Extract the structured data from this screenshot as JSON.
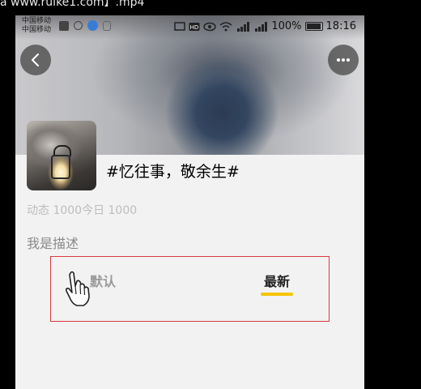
{
  "video": {
    "title": "a www.ruike1.com】.mp4"
  },
  "status_bar": {
    "carrier_1": "中国移动",
    "carrier_2": "中国移动",
    "battery": "100%",
    "time": "18:16"
  },
  "nav": {
    "back_icon": "chevron-left-icon",
    "more_icon": "ellipsis-icon"
  },
  "topic": {
    "title": "#忆往事，敬余生#",
    "stats": "动态 1000今日 1000",
    "description": "我是描述"
  },
  "tabs": [
    {
      "label": "默认",
      "active": false
    },
    {
      "label": "最新",
      "active": true
    }
  ],
  "colors": {
    "accent": "#f5c400",
    "outline": "#d9393e",
    "background": "#f2f2f2"
  }
}
